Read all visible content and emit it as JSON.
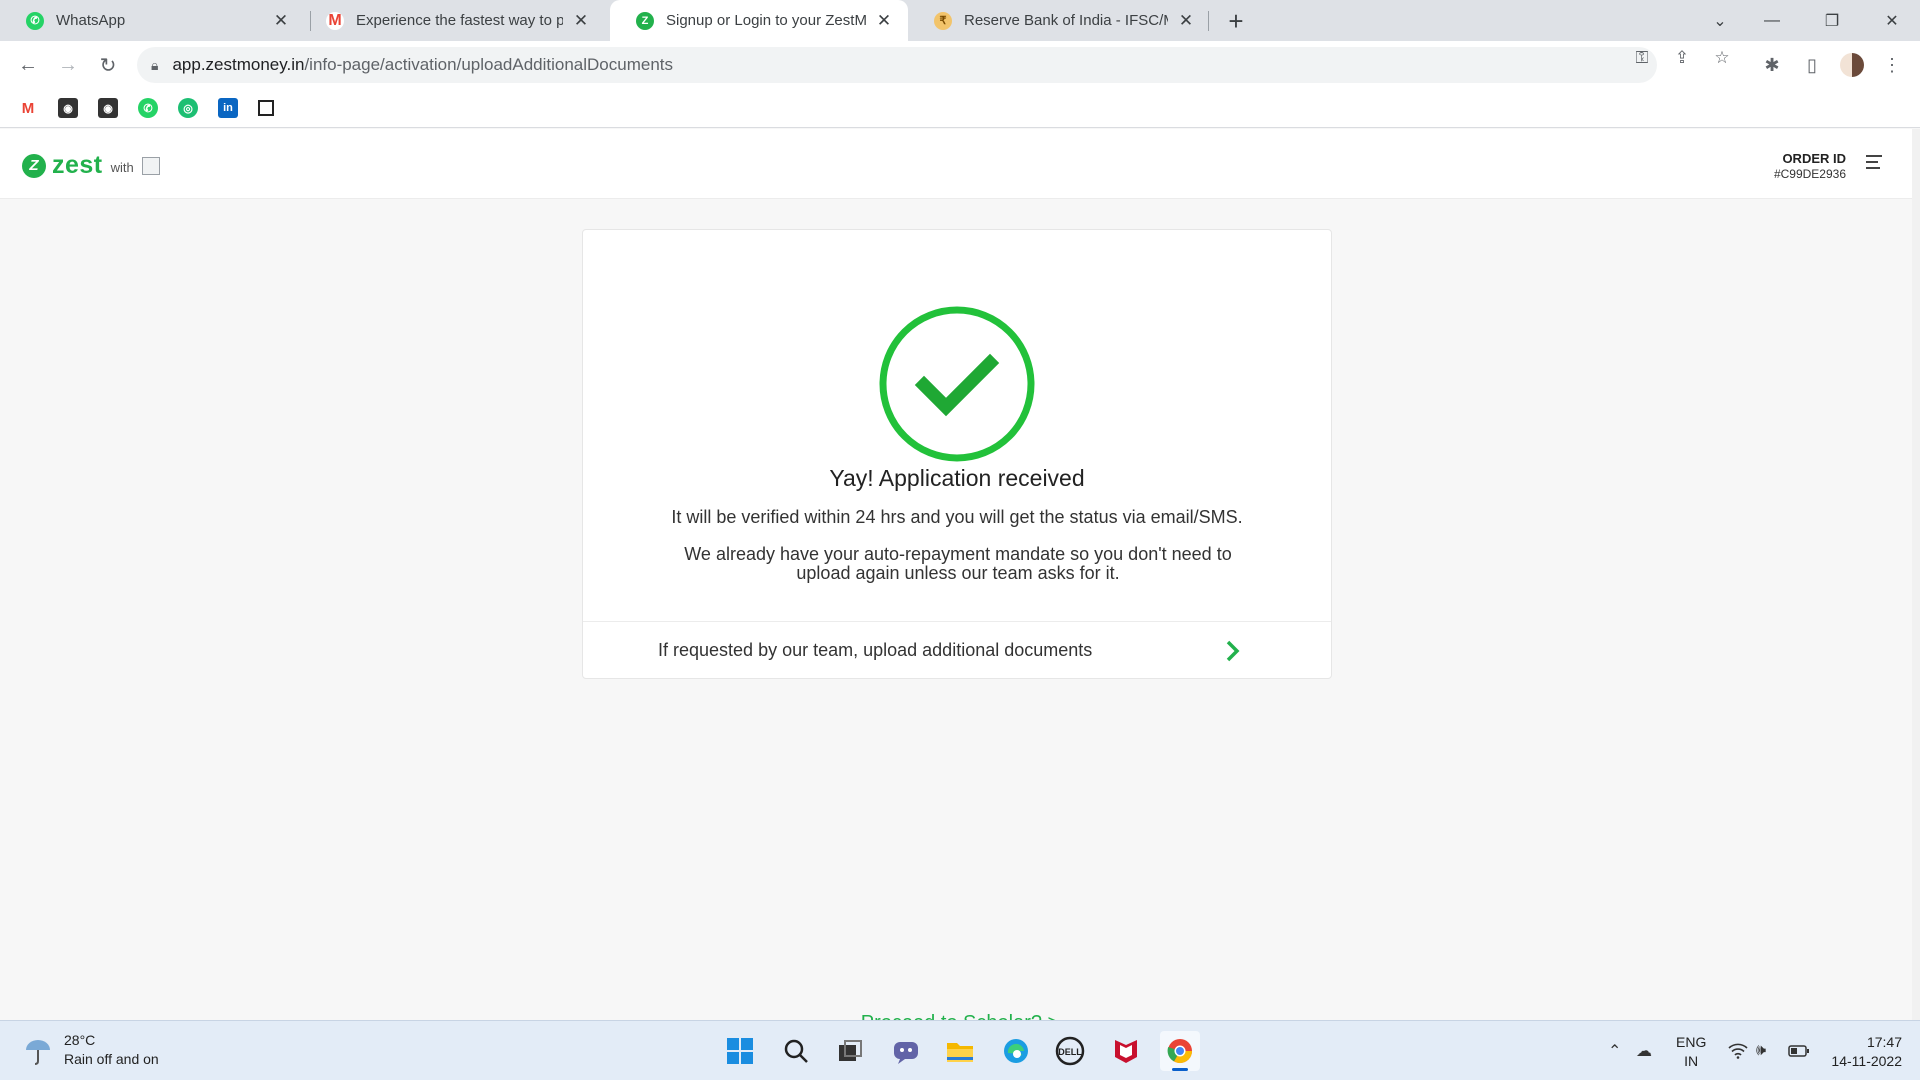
{
  "browser": {
    "tabs": [
      {
        "title": "WhatsApp",
        "icon": "whatsapp-icon",
        "active": false
      },
      {
        "title": "Experience the fastest way to pay",
        "icon": "gmail-icon",
        "active": false
      },
      {
        "title": "Signup or Login to your ZestMoney",
        "icon": "zestmoney-icon",
        "active": true
      },
      {
        "title": "Reserve Bank of India - IFSC/MICR",
        "icon": "rbi-icon",
        "active": false
      }
    ],
    "close_glyph": "✕",
    "new_tab_glyph": "+",
    "url_host": "app.zestmoney.in",
    "url_path": "/info-page/activation/uploadAdditionalDocuments",
    "bookmarks": [
      "gmail-icon",
      "dark-shield-icon",
      "dark-shield-icon",
      "whatsapp-icon",
      "green-app-icon",
      "linkedin-icon",
      "blank-page-icon"
    ]
  },
  "header": {
    "logo_text": "zest",
    "logo_with": "with",
    "order_label": "ORDER ID",
    "order_id": "#C99DE2936"
  },
  "card": {
    "title": "Yay! Application received",
    "line1": "It will be verified within 24 hrs and you will get the status via email/SMS.",
    "line2": "We already have your auto-repayment mandate so you don't need to upload again unless our team asks for it.",
    "action": "If requested by our team, upload additional documents"
  },
  "bottom_link": "Proceed to Scholar? >",
  "colors": {
    "accent": "#22b14c",
    "taskbar": "#e3ecf7"
  },
  "taskbar": {
    "temperature": "28°C",
    "weather": "Rain off and on",
    "apps": [
      "windows-start-icon",
      "search-icon",
      "task-view-icon",
      "teams-chat-icon",
      "file-explorer-icon",
      "edge-icon",
      "dell-icon",
      "mcafee-icon",
      "chrome-icon"
    ],
    "lang_top": "ENG",
    "lang_bottom": "IN",
    "time": "17:47",
    "date": "14-11-2022"
  }
}
